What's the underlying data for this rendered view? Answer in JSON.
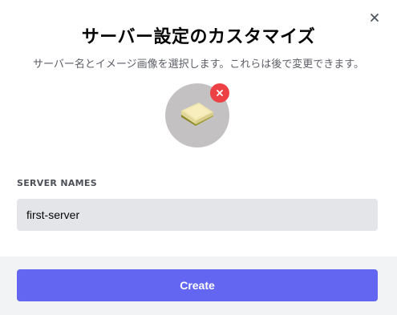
{
  "dialog": {
    "title": "サーバー設定のカスタマイズ",
    "subtitle": "サーバー名とイメージ画像を選択します。これらは後で変更できます。"
  },
  "avatar": {
    "image": "butter-icon",
    "remove_icon": "close-icon"
  },
  "server_name": {
    "label": "SERVER NAMES",
    "value": "first-server",
    "placeholder": ""
  },
  "footer": {
    "create_label": "Create"
  },
  "colors": {
    "accent": "#6266f1",
    "danger": "#ed4245",
    "footer_bg": "#f2f3f5",
    "input_bg": "#e3e5e8"
  }
}
